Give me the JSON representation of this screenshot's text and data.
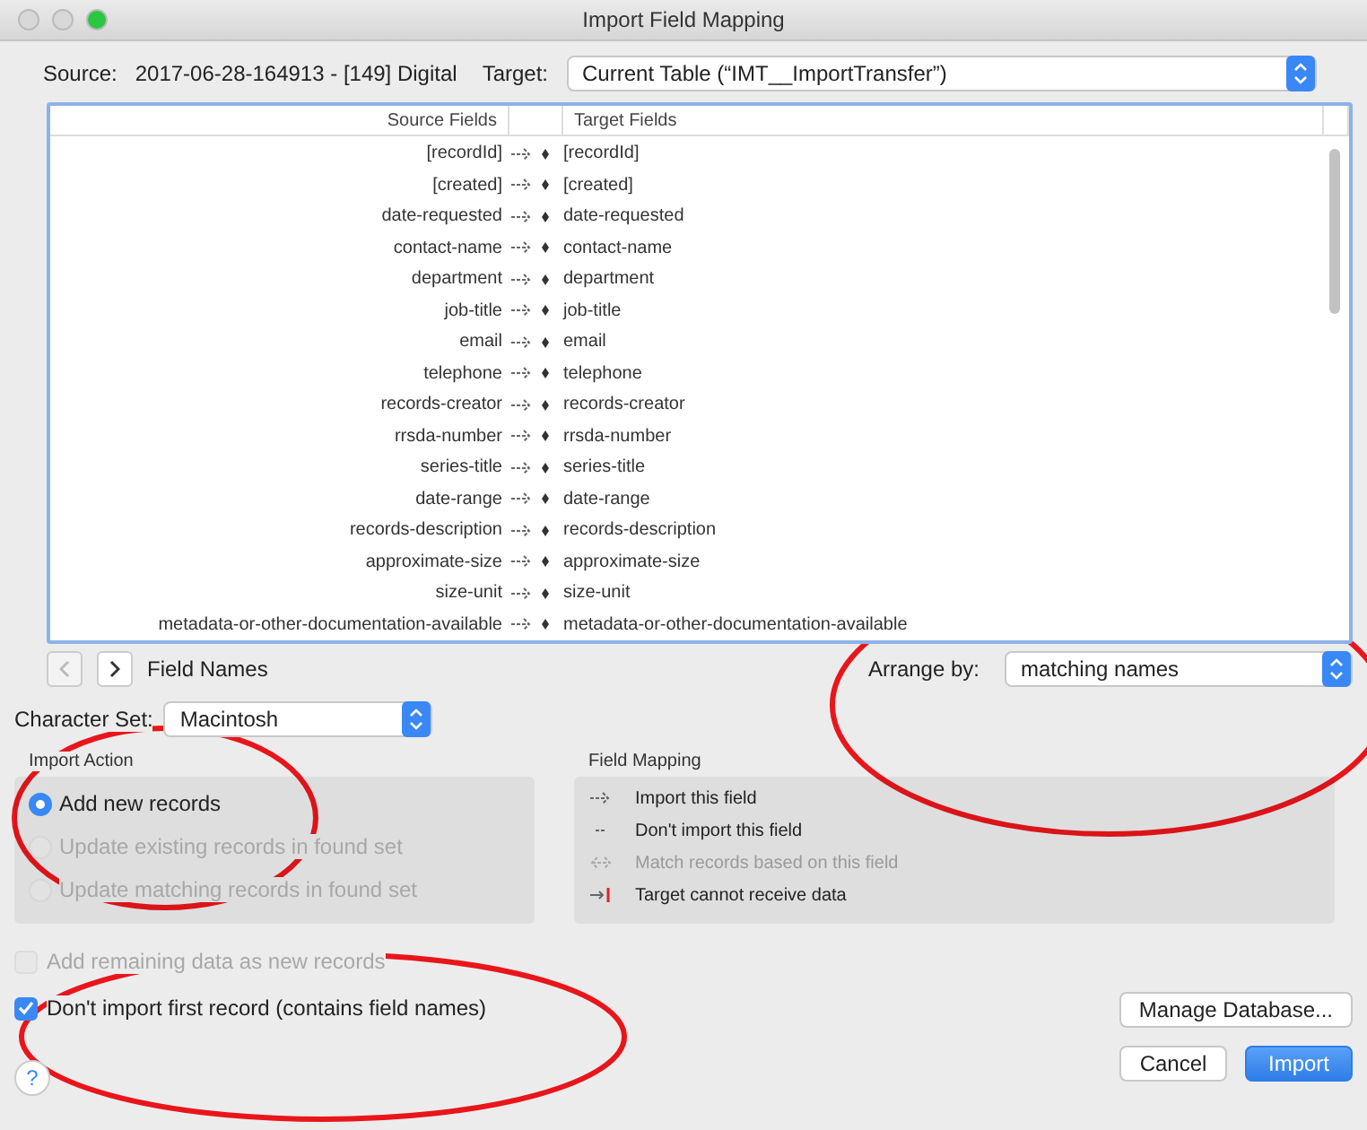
{
  "window": {
    "title": "Import Field Mapping"
  },
  "source": {
    "label": "Source:",
    "value": "2017-06-28-164913 - [149] Digital"
  },
  "target": {
    "label": "Target:",
    "value": "Current Table (“IMT__ImportTransfer”)"
  },
  "table": {
    "columns": [
      "Source Fields",
      "Target Fields"
    ],
    "rows": [
      {
        "source": "[recordId]",
        "kind": "import",
        "target": "[recordId]"
      },
      {
        "source": "[created]",
        "kind": "import",
        "target": "[created]"
      },
      {
        "source": "date-requested",
        "kind": "import",
        "target": "date-requested"
      },
      {
        "source": "contact-name",
        "kind": "import",
        "target": "contact-name"
      },
      {
        "source": "department",
        "kind": "import",
        "target": "department"
      },
      {
        "source": "job-title",
        "kind": "import",
        "target": "job-title"
      },
      {
        "source": "email",
        "kind": "import",
        "target": "email"
      },
      {
        "source": "telephone",
        "kind": "import",
        "target": "telephone"
      },
      {
        "source": "records-creator",
        "kind": "import",
        "target": "records-creator"
      },
      {
        "source": "rrsda-number",
        "kind": "import",
        "target": "rrsda-number"
      },
      {
        "source": "series-title",
        "kind": "import",
        "target": "series-title"
      },
      {
        "source": "date-range",
        "kind": "import",
        "target": "date-range"
      },
      {
        "source": "records-description",
        "kind": "import",
        "target": "records-description"
      },
      {
        "source": "approximate-size",
        "kind": "import",
        "target": "approximate-size"
      },
      {
        "source": "size-unit",
        "kind": "import",
        "target": "size-unit"
      },
      {
        "source": "metadata-or-other-documentation-available",
        "kind": "import",
        "target": "metadata-or-other-documentation-available"
      }
    ]
  },
  "navigation": {
    "label": "Field Names",
    "back_disabled": true
  },
  "arrange_by": {
    "label": "Arrange by:",
    "value": "matching names"
  },
  "character_set": {
    "label": "Character Set:",
    "value": "Macintosh"
  },
  "import_action": {
    "title": "Import Action",
    "options": [
      {
        "label": "Add new records",
        "selected": true,
        "disabled": false
      },
      {
        "label": "Update existing records in found set",
        "selected": false,
        "disabled": true
      },
      {
        "label": "Update matching records in found set",
        "selected": false,
        "disabled": true
      }
    ]
  },
  "field_mapping_legend": {
    "title": "Field Mapping",
    "items": [
      {
        "kind": "import",
        "label": "Import this field",
        "disabled": false
      },
      {
        "kind": "skip",
        "label": "Don't import this field",
        "disabled": false
      },
      {
        "kind": "match",
        "label": "Match records based on this field",
        "disabled": true
      },
      {
        "kind": "blocked",
        "label": "Target cannot receive data",
        "disabled": false
      }
    ]
  },
  "options": [
    {
      "label": "Add remaining data as new records",
      "checked": false,
      "disabled": true
    },
    {
      "label": "Don't import first record (contains field names)",
      "checked": true,
      "disabled": false
    }
  ],
  "buttons": [
    {
      "label": "Manage Database...",
      "kind": "secondary"
    },
    {
      "label": "Cancel",
      "kind": "secondary"
    },
    {
      "label": "Import",
      "kind": "primary"
    }
  ],
  "help": {
    "label": "?"
  }
}
